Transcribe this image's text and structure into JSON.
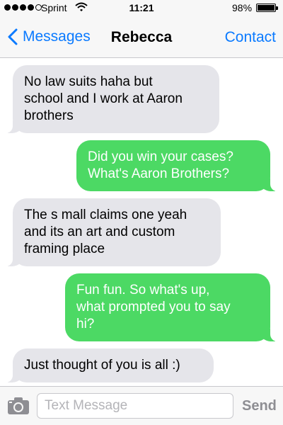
{
  "status_bar": {
    "carrier": "Sprint",
    "signal_bars_filled": 4,
    "signal_bars_total": 5,
    "time": "11:21",
    "battery_percent_label": "98%",
    "battery_level": 0.98,
    "icons": [
      "wifi-icon",
      "battery-icon"
    ]
  },
  "nav": {
    "back_label": "Messages",
    "title": "Rebecca",
    "contact_label": "Contact",
    "accent_color": "#0a7aff"
  },
  "messages": [
    {
      "direction": "incoming",
      "text": "No law suits haha but\nschool and I work at Aaron\nbrothers"
    },
    {
      "direction": "outgoing",
      "text": "Did you win your cases?\nWhat's Aaron Brothers?"
    },
    {
      "direction": "incoming",
      "text": "The s mall claims one yeah\nand its an art and custom\nframing place"
    },
    {
      "direction": "outgoing",
      "text": "Fun fun. So what's up,\nwhat prompted you to say\nhi?"
    },
    {
      "direction": "incoming",
      "text": "Just thought of you is all :)"
    }
  ],
  "colors": {
    "incoming_bubble": "#e5e5ea",
    "outgoing_bubble": "#4cd964"
  },
  "input_bar": {
    "placeholder": "Text Message",
    "value": "",
    "send_label": "Send",
    "camera_icon": "camera-icon"
  }
}
